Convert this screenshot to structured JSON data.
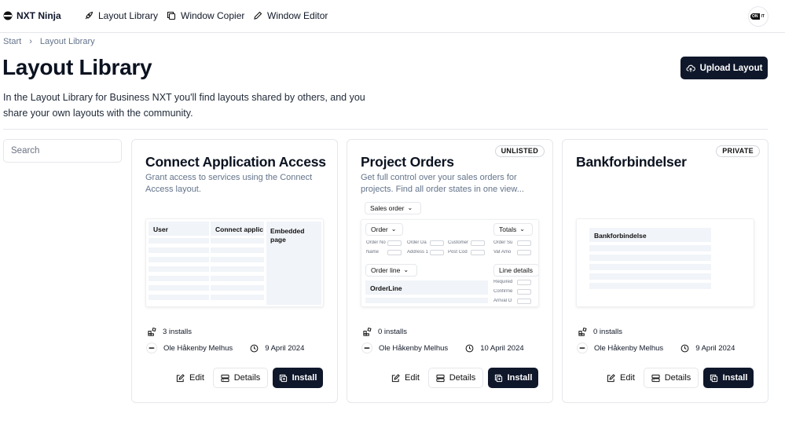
{
  "nav": {
    "brand": "NXT Ninja",
    "links": [
      "Layout Library",
      "Window Copier",
      "Window Editor"
    ],
    "avatar": [
      "ON",
      "IT"
    ]
  },
  "breadcrumb": [
    "Start",
    "Layout Library"
  ],
  "page": {
    "title": "Layout Library",
    "intro": "In the Layout Library for Business NXT you'll find layouts shared by others, and you share your own layouts with the community.",
    "upload_label": "Upload Layout"
  },
  "search": {
    "placeholder": "Search",
    "value": ""
  },
  "card_actions": {
    "edit": "Edit",
    "details": "Details",
    "install": "Install"
  },
  "cards": [
    {
      "title": "Connect Application Access",
      "description": "Grant access to services using the Connect Access layout.",
      "badge": "",
      "installs": "3 installs",
      "author": "Ole Håkenby Melhus",
      "date": "9 April 2024",
      "preview": {
        "col1": "User",
        "col2": "Connect applic",
        "side": "Embedded page"
      }
    },
    {
      "title": "Project Orders",
      "description": "Get full control over your sales orders for projects. Find all order states in one view...",
      "badge": "UNLISTED",
      "installs": "0 installs",
      "author": "Ole Håkenby Melhus",
      "date": "10 April 2024",
      "preview": {
        "sales_order": "Sales order",
        "order": "Order",
        "totals": "Totals",
        "fields_row1": [
          "Order No",
          "Order Da",
          "Customer"
        ],
        "fields_row2": [
          "Name",
          "Address 1",
          "Post Cod"
        ],
        "totals_fields": [
          "Order Su",
          "Vat Amo"
        ],
        "order_line": "Order line",
        "line_details": "Line details",
        "orderline_label": "OrderLine",
        "line_fields": [
          "Required",
          "Confirme",
          "Arrival O"
        ]
      }
    },
    {
      "title": "Bankforbindelser",
      "description": "",
      "badge": "PRIVATE",
      "installs": "0 installs",
      "author": "Ole Håkenby Melhus",
      "date": "9 April 2024",
      "preview": {
        "header": "Bankforbindelse"
      }
    }
  ]
}
